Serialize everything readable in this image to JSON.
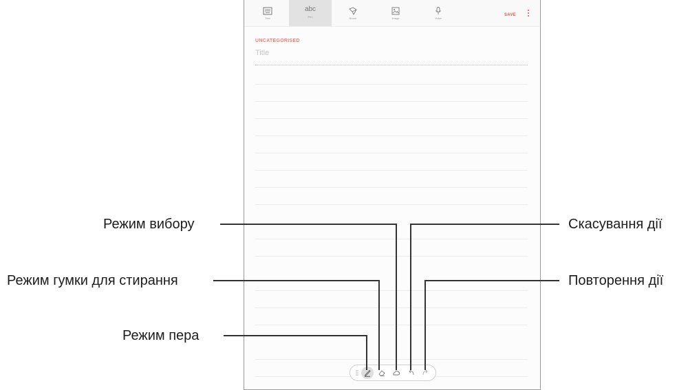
{
  "toolbar": {
    "tools": [
      {
        "label": "Text",
        "icon": "keyboard-icon"
      },
      {
        "label": "Pen",
        "icon_text": "abc",
        "active": true
      },
      {
        "label": "Brush",
        "icon": "brush-icon"
      },
      {
        "label": "Image",
        "icon": "image-icon"
      },
      {
        "label": "Voice",
        "icon": "microphone-icon"
      }
    ],
    "save_label": "SAVE",
    "more_icon": "more-options-icon"
  },
  "note": {
    "category": "UNCATEGORISED",
    "title_placeholder": "Title"
  },
  "pen_toolbar": {
    "buttons": [
      "drag-handle-icon",
      "pen-icon",
      "eraser-icon",
      "selection-icon",
      "undo-icon",
      "redo-icon"
    ],
    "selected": "pen-icon"
  },
  "callouts": {
    "selection_mode": "Режим вибору",
    "eraser_mode": "Режим гумки для стирання",
    "pen_mode": "Режим пера",
    "undo": "Скасування дії",
    "redo": "Повторення дії"
  },
  "colors": {
    "accent": "#e2564c",
    "category": "#ef7d73",
    "active_tool_bg": "#e2e2e2"
  }
}
